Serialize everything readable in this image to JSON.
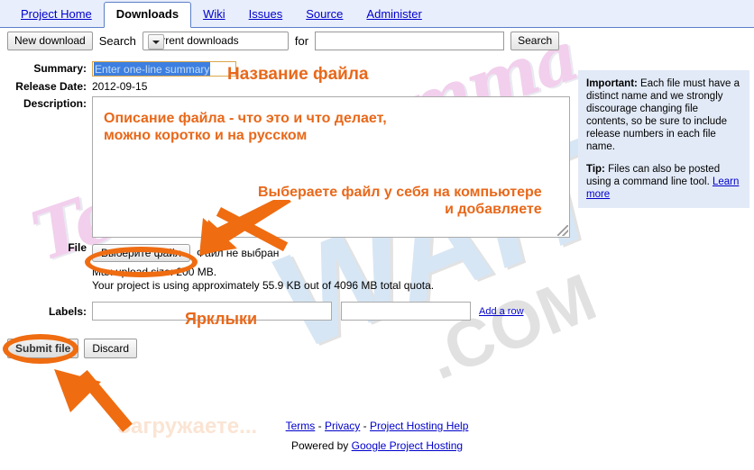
{
  "nav": {
    "tabs": [
      {
        "label": "Project Home",
        "active": false
      },
      {
        "label": "Downloads",
        "active": true
      },
      {
        "label": "Wiki",
        "active": false
      },
      {
        "label": "Issues",
        "active": false
      },
      {
        "label": "Source",
        "active": false
      },
      {
        "label": "Administer",
        "active": false
      }
    ]
  },
  "toolbar": {
    "new_download_label": "New download",
    "search_label": "Search",
    "scope_selected": "Current downloads",
    "for_label": "for",
    "search_value": "",
    "search_button_label": "Search"
  },
  "form": {
    "summary_label": "Summary:",
    "summary_value": "Enter one-line summary",
    "release_date_label": "Release Date:",
    "release_date_value": "2012-09-15",
    "description_label": "Description:",
    "description_value": "",
    "file_label": "File",
    "file_button_label": "Выберите файл",
    "file_status": "Файл не выбран",
    "max_upload": "Max upload size: 200 MB.",
    "quota_usage": "Your project is using approximately 55.9 KB out of 4096 MB total quota.",
    "labels_label": "Labels:",
    "label_value_1": "",
    "label_value_2": "",
    "add_row_label": "Add a row",
    "submit_label": "Submit file",
    "discard_label": "Discard"
  },
  "sidenote": {
    "important_head": "Important:",
    "important_body": " Each file must have a distinct name and we strongly discourage changing file contents, so be sure to include release numbers in each file name.",
    "tip_head": "Tip:",
    "tip_body": " Files can also be posted using a command line tool. ",
    "tip_link": "Learn more"
  },
  "footer": {
    "terms": "Terms",
    "sep1": " - ",
    "privacy": "Privacy",
    "sep2": " - ",
    "help": "Project Hosting Help",
    "powered_prefix": "Powered by ",
    "powered_link": "Google Project Hosting"
  },
  "annotations": {
    "title": "Названиe файла",
    "description": "Описание файла - что это и что делает,\nможно коротко и на русском",
    "file": "Выбераете файл у себя на компьютере\nи добавляете",
    "labels": "Ярклыки",
    "uploading": "Загружаете..."
  },
  "watermarks": {
    "script": "Teleprogramma",
    "blue": "WAIT",
    "com": ".COM"
  },
  "colors": {
    "accent_orange": "#ef6c11",
    "link_blue": "#0000cc",
    "tab_bar_bg": "#e8eefb",
    "sidenote_bg": "#e2eaf7",
    "summary_border": "#d9a74b",
    "selection_blue": "#3d7fe0"
  }
}
